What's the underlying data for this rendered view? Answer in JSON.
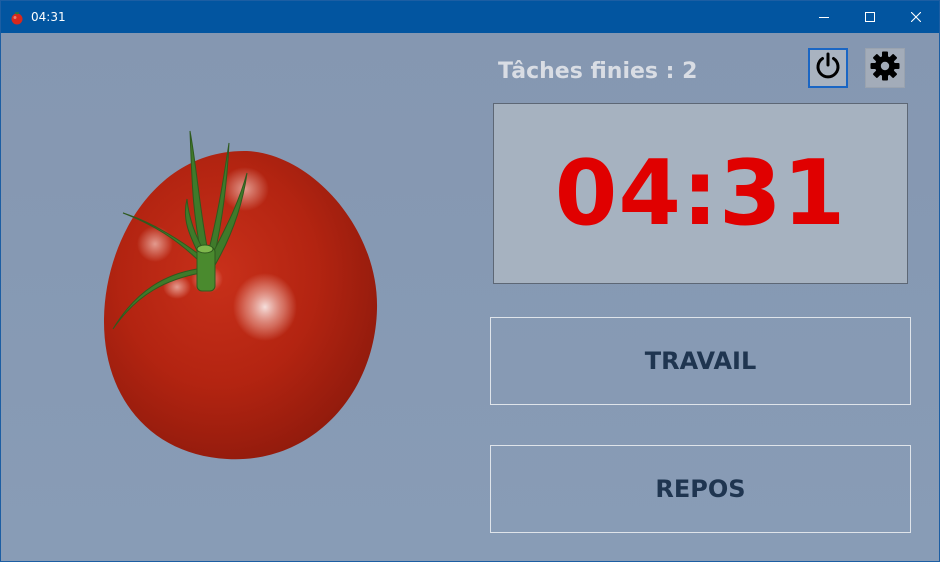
{
  "window": {
    "title": "04:31",
    "icons": {
      "app": "tomato-icon",
      "minimize": "minimize-icon",
      "maximize": "maximize-icon",
      "close": "close-icon"
    }
  },
  "main": {
    "tasks_label": "Tâches finies : 2",
    "timer": "04:31",
    "buttons": {
      "power_icon": "power-icon",
      "settings_icon": "gear-icon",
      "work_label": "TRAVAIL",
      "rest_label": "REPOS"
    },
    "illustration": "tomato-illustration"
  },
  "colors": {
    "titlebar": "#0255a0",
    "background": "#8a9db5",
    "timer_text": "#e00000",
    "button_text": "#1f3550",
    "tomato": "#b0210f"
  }
}
